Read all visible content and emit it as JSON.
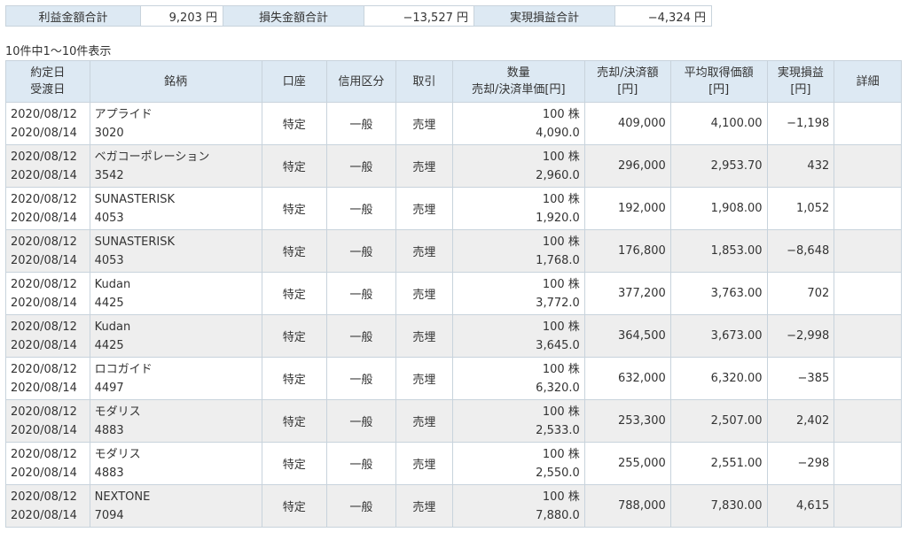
{
  "summary": {
    "profit_label": "利益金額合計",
    "profit_value": "9,203 円",
    "loss_label": "損失金額合計",
    "loss_value": "−13,527 円",
    "net_label": "実現損益合計",
    "net_value": "−4,324 円"
  },
  "count_text": "10件中1〜10件表示",
  "headers": {
    "date_line1": "約定日",
    "date_line2": "受渡日",
    "name": "銘柄",
    "account": "口座",
    "credit": "信用区分",
    "trade": "取引",
    "qty_line1": "数量",
    "qty_line2": "売却/決済単価[円]",
    "sale_line1": "売却/決済額",
    "sale_line2": "[円]",
    "avg_line1": "平均取得価額",
    "avg_line2": "[円]",
    "pl_line1": "実現損益",
    "pl_line2": "[円]",
    "detail": "詳細"
  },
  "rows": [
    {
      "trade_date": "2020/08/12",
      "settle_date": "2020/08/14",
      "name": "アプライド",
      "code": "3020",
      "account": "特定",
      "credit": "一般",
      "trade": "売埋",
      "qty": "100 株",
      "price": "4,090.0",
      "sale": "409,000",
      "avg": "4,100.00",
      "pl": "−1,198"
    },
    {
      "trade_date": "2020/08/12",
      "settle_date": "2020/08/14",
      "name": "ベガコーポレーション",
      "code": "3542",
      "account": "特定",
      "credit": "一般",
      "trade": "売埋",
      "qty": "100 株",
      "price": "2,960.0",
      "sale": "296,000",
      "avg": "2,953.70",
      "pl": "432"
    },
    {
      "trade_date": "2020/08/12",
      "settle_date": "2020/08/14",
      "name": "SUNASTERISK",
      "code": "4053",
      "account": "特定",
      "credit": "一般",
      "trade": "売埋",
      "qty": "100 株",
      "price": "1,920.0",
      "sale": "192,000",
      "avg": "1,908.00",
      "pl": "1,052"
    },
    {
      "trade_date": "2020/08/12",
      "settle_date": "2020/08/14",
      "name": "SUNASTERISK",
      "code": "4053",
      "account": "特定",
      "credit": "一般",
      "trade": "売埋",
      "qty": "100 株",
      "price": "1,768.0",
      "sale": "176,800",
      "avg": "1,853.00",
      "pl": "−8,648"
    },
    {
      "trade_date": "2020/08/12",
      "settle_date": "2020/08/14",
      "name": "Kudan",
      "code": "4425",
      "account": "特定",
      "credit": "一般",
      "trade": "売埋",
      "qty": "100 株",
      "price": "3,772.0",
      "sale": "377,200",
      "avg": "3,763.00",
      "pl": "702"
    },
    {
      "trade_date": "2020/08/12",
      "settle_date": "2020/08/14",
      "name": "Kudan",
      "code": "4425",
      "account": "特定",
      "credit": "一般",
      "trade": "売埋",
      "qty": "100 株",
      "price": "3,645.0",
      "sale": "364,500",
      "avg": "3,673.00",
      "pl": "−2,998"
    },
    {
      "trade_date": "2020/08/12",
      "settle_date": "2020/08/14",
      "name": "ロコガイド",
      "code": "4497",
      "account": "特定",
      "credit": "一般",
      "trade": "売埋",
      "qty": "100 株",
      "price": "6,320.0",
      "sale": "632,000",
      "avg": "6,320.00",
      "pl": "−385"
    },
    {
      "trade_date": "2020/08/12",
      "settle_date": "2020/08/14",
      "name": "モダリス",
      "code": "4883",
      "account": "特定",
      "credit": "一般",
      "trade": "売埋",
      "qty": "100 株",
      "price": "2,533.0",
      "sale": "253,300",
      "avg": "2,507.00",
      "pl": "2,402"
    },
    {
      "trade_date": "2020/08/12",
      "settle_date": "2020/08/14",
      "name": "モダリス",
      "code": "4883",
      "account": "特定",
      "credit": "一般",
      "trade": "売埋",
      "qty": "100 株",
      "price": "2,550.0",
      "sale": "255,000",
      "avg": "2,551.00",
      "pl": "−298"
    },
    {
      "trade_date": "2020/08/12",
      "settle_date": "2020/08/14",
      "name": "NEXTONE",
      "code": "7094",
      "account": "特定",
      "credit": "一般",
      "trade": "売埋",
      "qty": "100 株",
      "price": "7,880.0",
      "sale": "788,000",
      "avg": "7,830.00",
      "pl": "4,615"
    }
  ]
}
